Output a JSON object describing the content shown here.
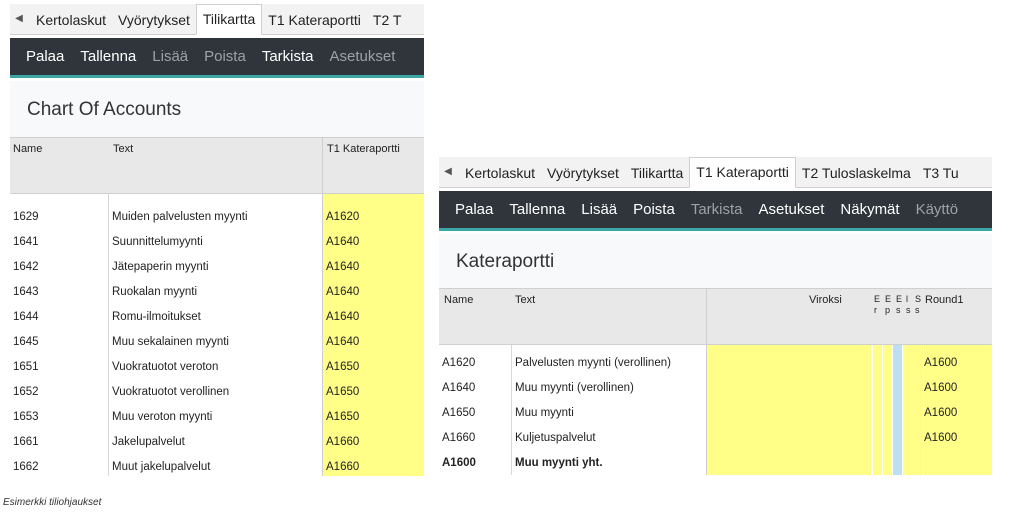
{
  "left": {
    "tabs": [
      "Kertolaskut",
      "Vyörytykset",
      "Tilikartta",
      "T1 Kateraportti",
      "T2 T"
    ],
    "active_tab": 2,
    "toolbar": [
      {
        "label": "Palaa",
        "enabled": true
      },
      {
        "label": "Tallenna",
        "enabled": true
      },
      {
        "label": "Lisää",
        "enabled": false
      },
      {
        "label": "Poista",
        "enabled": false
      },
      {
        "label": "Tarkista",
        "enabled": true
      },
      {
        "label": "Asetukset",
        "enabled": false
      }
    ],
    "title": "Chart Of Accounts",
    "columns": {
      "name": "Name",
      "text": "Text",
      "t1": "T1 Kateraportti"
    },
    "rows": [
      {
        "name": "1629",
        "text": "Muiden palvelusten myynti",
        "t1": "A1620"
      },
      {
        "name": "1641",
        "text": "Suunnittelumyynti",
        "t1": "A1640"
      },
      {
        "name": "1642",
        "text": "Jätepaperin myynti",
        "t1": "A1640"
      },
      {
        "name": "1643",
        "text": "Ruokalan myynti",
        "t1": "A1640"
      },
      {
        "name": "1644",
        "text": "Romu-ilmoitukset",
        "t1": "A1640"
      },
      {
        "name": "1645",
        "text": "Muu sekalainen myynti",
        "t1": "A1640"
      },
      {
        "name": "1651",
        "text": "Vuokratuotot veroton",
        "t1": "A1650"
      },
      {
        "name": "1652",
        "text": "Vuokratuotot verollinen",
        "t1": "A1650"
      },
      {
        "name": "1653",
        "text": "Muu veroton myynti",
        "t1": "A1650"
      },
      {
        "name": "1661",
        "text": "Jakelupalvelut",
        "t1": "A1660"
      },
      {
        "name": "1662",
        "text": "Muut jakelupalvelut",
        "t1": "A1660"
      }
    ]
  },
  "right": {
    "tabs": [
      "Kertolaskut",
      "Vyörytykset",
      "Tilikartta",
      "T1 Kateraportti",
      "T2 Tuloslaskelma",
      "T3 Tu"
    ],
    "active_tab": 3,
    "toolbar": [
      {
        "label": "Palaa",
        "enabled": true
      },
      {
        "label": "Tallenna",
        "enabled": true
      },
      {
        "label": "Lisää",
        "enabled": true
      },
      {
        "label": "Poista",
        "enabled": true
      },
      {
        "label": "Tarkista",
        "enabled": false
      },
      {
        "label": "Asetukset",
        "enabled": true
      },
      {
        "label": "Näkymät",
        "enabled": true
      },
      {
        "label": "Käyttö",
        "enabled": false
      }
    ],
    "title": "Kateraportti",
    "columns": {
      "name": "Name",
      "text": "Text",
      "viroksi": "Viroksi",
      "narrow": [
        "E r",
        "E p",
        "E s",
        "l s",
        "S s"
      ],
      "round1": "Round1"
    },
    "rows": [
      {
        "name": "A1620",
        "text": "Palvelusten myynti (verollinen)",
        "round1": "A1600",
        "bold": false
      },
      {
        "name": "A1640",
        "text": "Muu myynti (verollinen)",
        "round1": "A1600",
        "bold": false
      },
      {
        "name": "A1650",
        "text": "Muu myynti",
        "round1": "A1600",
        "bold": false
      },
      {
        "name": "A1660",
        "text": "Kuljetuspalvelut",
        "round1": "A1600",
        "bold": false
      },
      {
        "name": "A1600",
        "text": "Muu myynti yht.",
        "round1": "",
        "bold": true
      }
    ]
  },
  "caption": "Esimerkki tiliohjaukset",
  "colors": {
    "toolbar_bg": "#2f353b",
    "accent": "#3aa7a4",
    "highlight": "#ffff88",
    "blue_cell": "#bcdff2"
  }
}
